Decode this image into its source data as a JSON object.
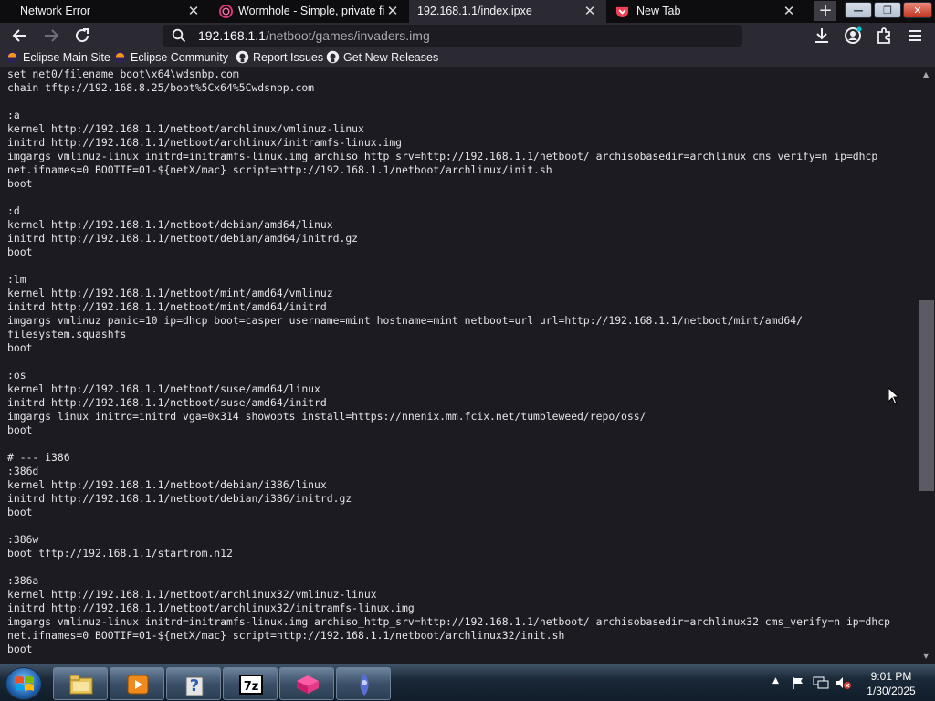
{
  "tabs": [
    {
      "title": "Network Error",
      "active": false,
      "favicon": "none"
    },
    {
      "title": "Wormhole - Simple, private file",
      "active": false,
      "favicon": "wormhole-icon"
    },
    {
      "title": "192.168.1.1/index.ipxe",
      "active": true,
      "favicon": "none"
    },
    {
      "title": "New Tab",
      "active": false,
      "favicon": "pocket-icon"
    }
  ],
  "window_buttons": {
    "minimize": "—",
    "maximize": "❐",
    "close": "✕"
  },
  "new_tab_label": "+",
  "url": {
    "host": "192.168.1.1",
    "path": "/netboot/games/invaders.img"
  },
  "bookmarks": [
    {
      "label": "Eclipse Main Site",
      "icon": "eclipse-icon"
    },
    {
      "label": "Eclipse Community",
      "icon": "eclipse-icon"
    },
    {
      "label": "Report Issues",
      "icon": "github-icon"
    },
    {
      "label": "Get New Releases",
      "icon": "github-icon"
    }
  ],
  "source_lines": [
    "set net0/filename boot\\x64\\wdsnbp.com",
    "chain tftp://192.168.8.25/boot%5Cx64%5Cwdsnbp.com",
    "",
    ":a",
    "kernel http://192.168.1.1/netboot/archlinux/vmlinuz-linux",
    "initrd http://192.168.1.1/netboot/archlinux/initramfs-linux.img",
    "imgargs vmlinuz-linux initrd=initramfs-linux.img archiso_http_srv=http://192.168.1.1/netboot/ archisobasedir=archlinux cms_verify=n ip=dhcp",
    "net.ifnames=0 BOOTIF=01-${netX/mac} script=http://192.168.1.1/netboot/archlinux/init.sh",
    "boot",
    "",
    ":d",
    "kernel http://192.168.1.1/netboot/debian/amd64/linux",
    "initrd http://192.168.1.1/netboot/debian/amd64/initrd.gz",
    "boot",
    "",
    ":lm",
    "kernel http://192.168.1.1/netboot/mint/amd64/vmlinuz",
    "initrd http://192.168.1.1/netboot/mint/amd64/initrd",
    "imgargs vmlinuz panic=10 ip=dhcp boot=casper username=mint hostname=mint netboot=url url=http://192.168.1.1/netboot/mint/amd64/",
    "filesystem.squashfs",
    "boot",
    "",
    ":os",
    "kernel http://192.168.1.1/netboot/suse/amd64/linux",
    "initrd http://192.168.1.1/netboot/suse/amd64/initrd",
    "imgargs linux initrd=initrd vga=0x314 showopts install=https://nnenix.mm.fcix.net/tumbleweed/repo/oss/",
    "boot",
    "",
    "# --- i386",
    ":386d",
    "kernel http://192.168.1.1/netboot/debian/i386/linux",
    "initrd http://192.168.1.1/netboot/debian/i386/initrd.gz",
    "boot",
    "",
    ":386w",
    "boot tftp://192.168.1.1/startrom.n12",
    "",
    ":386a",
    "kernel http://192.168.1.1/netboot/archlinux32/vmlinuz-linux",
    "initrd http://192.168.1.1/netboot/archlinux32/initramfs-linux.img",
    "imgargs vmlinuz-linux initrd=initramfs-linux.img archiso_http_srv=http://192.168.1.1/netboot/ archisobasedir=archlinux32 cms_verify=n ip=dhcp",
    "net.ifnames=0 BOOTIF=01-${netX/mac} script=http://192.168.1.1/netboot/archlinux32/init.sh",
    "boot"
  ],
  "taskbar_items": [
    {
      "name": "explorer-icon"
    },
    {
      "name": "media-player-icon"
    },
    {
      "name": "help-icon"
    },
    {
      "name": "7zip-icon",
      "label": "7z"
    },
    {
      "name": "wormhole-app-icon"
    },
    {
      "name": "ipxe-app-icon"
    }
  ],
  "clock": {
    "time": "9:01 PM",
    "date": "1/30/2025"
  },
  "colors": {
    "accent": "#0060df",
    "tab_active": "#2b2a33",
    "page_bg": "#1c1b22"
  }
}
